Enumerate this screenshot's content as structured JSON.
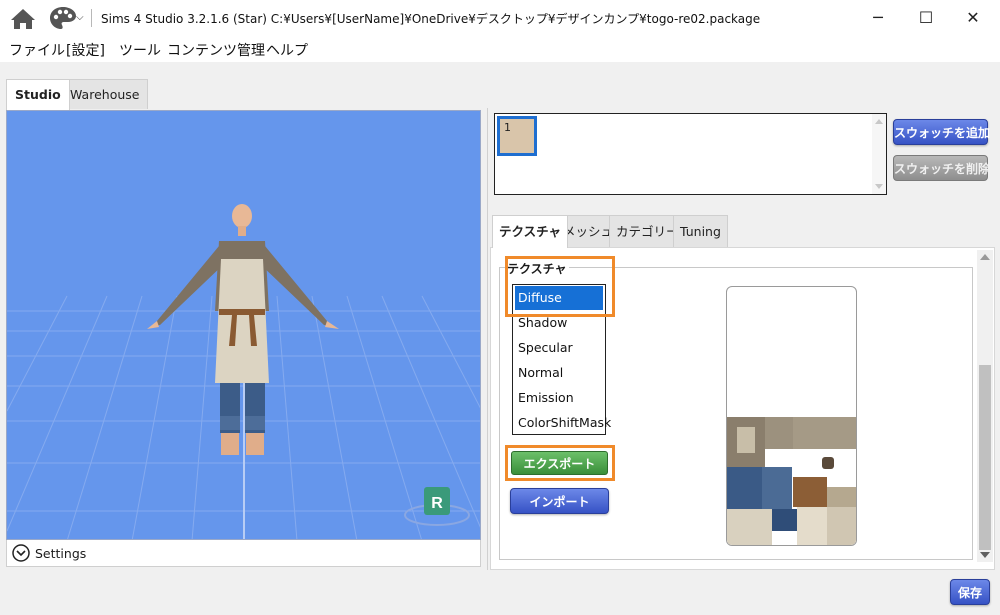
{
  "app": {
    "title": "Sims 4 Studio 3.2.1.6 (Star)  C:¥Users¥[UserName]¥OneDrive¥デスクトップ¥デザインカンプ¥togo-re02.package",
    "window_buttons": {
      "minimize": "─",
      "maximize": "☐",
      "close": "✕"
    }
  },
  "menu": {
    "items": [
      "ファイル",
      "[設定]",
      "ツール",
      "コンテンツ管理",
      "ヘルプ"
    ]
  },
  "left_tabs": [
    "Studio",
    "Warehouse"
  ],
  "viewport": {
    "gizmo_label": "R"
  },
  "settings": {
    "label": "Settings"
  },
  "swatches": {
    "items": [
      {
        "number": "1",
        "color": "#d9c5aa"
      }
    ],
    "add_label": "スウォッチを追加",
    "delete_label": "スウォッチを削除"
  },
  "right_tabs": [
    "テクスチャ",
    "メッシュ",
    "カテゴリー",
    "Tuning"
  ],
  "texture": {
    "group_label": "テクスチャ",
    "items": [
      "Diffuse",
      "Shadow",
      "Specular",
      "Normal",
      "Emission",
      "ColorShiftMask"
    ],
    "selected": "Diffuse",
    "export_label": "エクスポート",
    "import_label": "インポート"
  },
  "save_label": "保存",
  "colors": {
    "viewport_bg": "#6596ec",
    "accent_blue": "#1670d6",
    "highlight_orange": "#f08a2a"
  }
}
